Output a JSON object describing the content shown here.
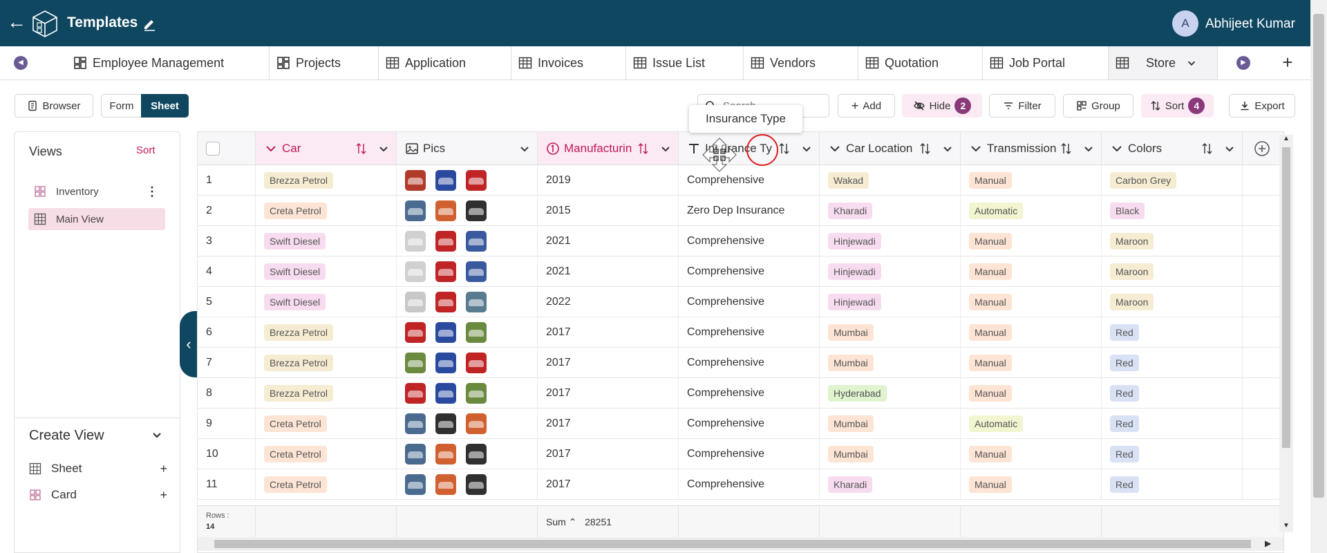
{
  "header": {
    "title": "Templates",
    "user_initial": "A",
    "user_name": "Abhijeet Kumar"
  },
  "tabs": [
    {
      "label": "Employee Management",
      "icon": "dashboard-icon"
    },
    {
      "label": "Projects",
      "icon": "dashboard-icon"
    },
    {
      "label": "Application",
      "icon": "table-icon"
    },
    {
      "label": "Invoices",
      "icon": "table-icon"
    },
    {
      "label": "Issue List",
      "icon": "table-icon"
    },
    {
      "label": "Vendors",
      "icon": "table-icon"
    },
    {
      "label": "Quotation",
      "icon": "table-icon"
    },
    {
      "label": "Job Portal",
      "icon": "table-icon"
    },
    {
      "label": "Store",
      "icon": "table-icon",
      "active": true
    }
  ],
  "toolbar": {
    "browser_label": "Browser",
    "form_label": "Form",
    "sheet_label": "Sheet",
    "search_placeholder": "Search",
    "add_label": "Add",
    "hide_label": "Hide",
    "hide_count": "2",
    "filter_label": "Filter",
    "group_label": "Group",
    "sort_label": "Sort",
    "sort_count": "4",
    "export_label": "Export"
  },
  "tooltip": "Insurance Type",
  "sidebar": {
    "views_title": "Views",
    "views_sort": "Sort",
    "views": [
      {
        "label": "Inventory",
        "icon": "card-icon"
      },
      {
        "label": "Main View",
        "icon": "table-icon",
        "active": true
      }
    ],
    "create_title": "Create View",
    "create_items": [
      {
        "label": "Sheet",
        "icon": "table-icon"
      },
      {
        "label": "Card",
        "icon": "card-icon"
      }
    ]
  },
  "columns": [
    {
      "label": "Car",
      "icon": "chevron-icon",
      "pink": true
    },
    {
      "label": "Pics",
      "icon": "image-icon"
    },
    {
      "label": "Manufacturin",
      "icon": "number-icon",
      "pink": true
    },
    {
      "label": "Insurance Ty",
      "icon": "text-icon"
    },
    {
      "label": "Car Location",
      "icon": "chevron-icon"
    },
    {
      "label": "Transmission",
      "icon": "chevron-icon"
    },
    {
      "label": "Colors",
      "icon": "chevron-icon"
    }
  ],
  "colors": {
    "car_tag": {
      "Brezza Petrol": "#f5ecd2",
      "Creta Petrol": "#fde4d4",
      "Swift Diesel": "#f7dcef"
    },
    "location_tag": {
      "Wakad": "#f5ecd2",
      "Kharadi": "#f7dcef",
      "Hinjewadi": "#f7dcef",
      "Mumbai": "#fde4d4",
      "Hyderabad": "#dff3cf"
    },
    "transmission_tag": {
      "Manual": "#fde4d4",
      "Automatic": "#f2f5cf"
    },
    "color_tag": {
      "Carbon Grey": "#f5ecd2",
      "Black": "#f7dcef",
      "Maroon": "#f5ecd2",
      "Red": "#d9e1f5"
    }
  },
  "rows": [
    {
      "n": "1",
      "car": "Brezza Petrol",
      "pics": [
        "#b23a2a",
        "#2a4aa0",
        "#c02424"
      ],
      "year": "2019",
      "ins": "Comprehensive",
      "loc": "Wakad",
      "trans": "Manual",
      "color": "Carbon Grey"
    },
    {
      "n": "2",
      "car": "Creta Petrol",
      "pics": [
        "#4a6a90",
        "#d06030",
        "#303030"
      ],
      "year": "2015",
      "ins": "Zero Dep Insurance",
      "loc": "Kharadi",
      "trans": "Automatic",
      "color": "Black"
    },
    {
      "n": "3",
      "car": "Swift Diesel",
      "pics": [
        "#d0d0d0",
        "#c02424",
        "#3a5aa0"
      ],
      "year": "2021",
      "ins": "Comprehensive",
      "loc": "Hinjewadi",
      "trans": "Manual",
      "color": "Maroon"
    },
    {
      "n": "4",
      "car": "Swift Diesel",
      "pics": [
        "#d0d0d0",
        "#c02424",
        "#3a5aa0"
      ],
      "year": "2021",
      "ins": "Comprehensive",
      "loc": "Hinjewadi",
      "trans": "Manual",
      "color": "Maroon"
    },
    {
      "n": "5",
      "car": "Swift Diesel",
      "pics": [
        "#c8c8c8",
        "#c02424",
        "#5a7a90"
      ],
      "year": "2022",
      "ins": "Comprehensive",
      "loc": "Hinjewadi",
      "trans": "Manual",
      "color": "Maroon"
    },
    {
      "n": "6",
      "car": "Brezza Petrol",
      "pics": [
        "#c02424",
        "#2a4aa0",
        "#6a8a40"
      ],
      "year": "2017",
      "ins": "Comprehensive",
      "loc": "Mumbai",
      "trans": "Manual",
      "color": "Red"
    },
    {
      "n": "7",
      "car": "Brezza Petrol",
      "pics": [
        "#6a8a40",
        "#2a4aa0",
        "#c02424"
      ],
      "year": "2017",
      "ins": "Comprehensive",
      "loc": "Mumbai",
      "trans": "Manual",
      "color": "Red"
    },
    {
      "n": "8",
      "car": "Brezza Petrol",
      "pics": [
        "#c02424",
        "#2a4aa0",
        "#6a8a40"
      ],
      "year": "2017",
      "ins": "Comprehensive",
      "loc": "Hyderabad",
      "trans": "Manual",
      "color": "Red"
    },
    {
      "n": "9",
      "car": "Creta Petrol",
      "pics": [
        "#4a6a90",
        "#303030",
        "#d06030"
      ],
      "year": "2017",
      "ins": "Comprehensive",
      "loc": "Mumbai",
      "trans": "Automatic",
      "color": "Red"
    },
    {
      "n": "10",
      "car": "Creta Petrol",
      "pics": [
        "#4a6a90",
        "#d06030",
        "#303030"
      ],
      "year": "2017",
      "ins": "Comprehensive",
      "loc": "Mumbai",
      "trans": "Manual",
      "color": "Red"
    },
    {
      "n": "11",
      "car": "Creta Petrol",
      "pics": [
        "#4a6a90",
        "#d06030",
        "#303030"
      ],
      "year": "2017",
      "ins": "Comprehensive",
      "loc": "Kharadi",
      "trans": "Manual",
      "color": "Red"
    }
  ],
  "footer": {
    "rows_label": "Rows :",
    "rows_count": "14",
    "sum_label": "Sum",
    "sum_value": "28251"
  }
}
